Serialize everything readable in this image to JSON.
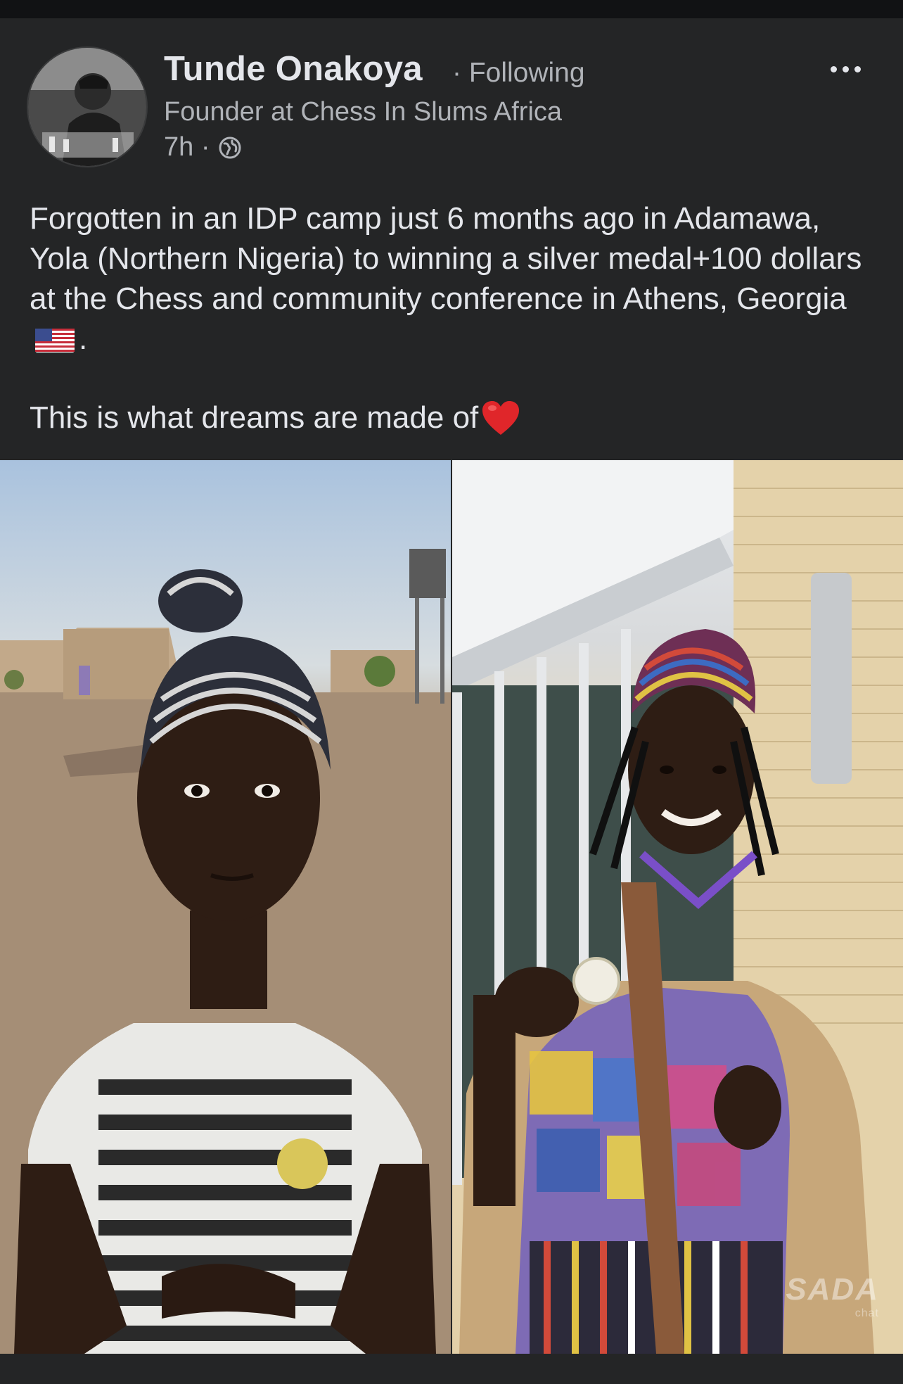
{
  "post": {
    "author_name": "Tunde Onakoya",
    "follow_status": "· Following",
    "author_title": "Founder at Chess In Slums Africa",
    "time_ago": "7h ·",
    "body_text": "Forgotten in an IDP camp just 6 months ago in Adamawa, Yola (Northern Nigeria) to winning a silver medal+100 dollars at the Chess and community conference in Athens, Georgia",
    "body_text_end": ".",
    "closing_line": "This is what dreams are made of",
    "flag_emoji": "us-flag-icon",
    "heart_emoji": "red-heart-icon"
  },
  "watermark": {
    "logo": "SADA",
    "sub": "chat"
  },
  "colors": {
    "background": "#242526",
    "primary_text": "#e4e6eb",
    "secondary_text": "#b0b3b8"
  }
}
